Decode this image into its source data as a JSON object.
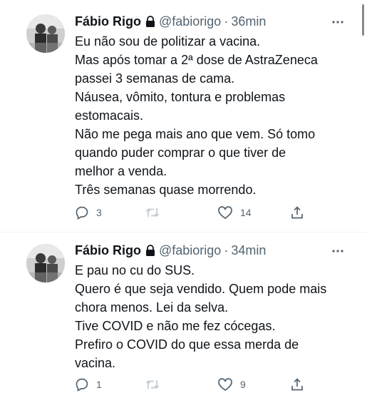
{
  "tweets": [
    {
      "author": "Fábio Rigo",
      "handle": "@fabiorigo",
      "separator": "·",
      "time": "36min",
      "lines": [
        "Eu não sou de politizar a vacina.",
        "Mas após tomar a 2ª dose de AstraZeneca",
        "passei 3 semanas de cama.",
        "Náusea, vômito, tontura e problemas",
        "estomacais.",
        "Não me pega mais ano que vem. Só tomo",
        "quando puder comprar o que tiver de",
        "melhor a venda.",
        "Três semanas quase morrendo."
      ],
      "replies": "3",
      "retweets": "",
      "likes": "14"
    },
    {
      "author": "Fábio Rigo",
      "handle": "@fabiorigo",
      "separator": "·",
      "time": "34min",
      "lines": [
        "E pau no cu do SUS.",
        "Quero é que seja vendido. Quem pode mais",
        "chora menos. Lei da selva.",
        "Tive COVID e não me fez cócegas.",
        "Prefiro o COVID do que essa merda de",
        "vacina."
      ],
      "replies": "1",
      "retweets": "",
      "likes": "9"
    }
  ],
  "icons": {
    "lock": "lock-icon",
    "more": "more-options-icon",
    "reply": "reply-icon",
    "retweet": "retweet-icon",
    "like": "like-icon",
    "share": "share-icon"
  },
  "colors": {
    "text": "#0f1419",
    "secondary": "#536471",
    "divider": "#eff3f4"
  }
}
